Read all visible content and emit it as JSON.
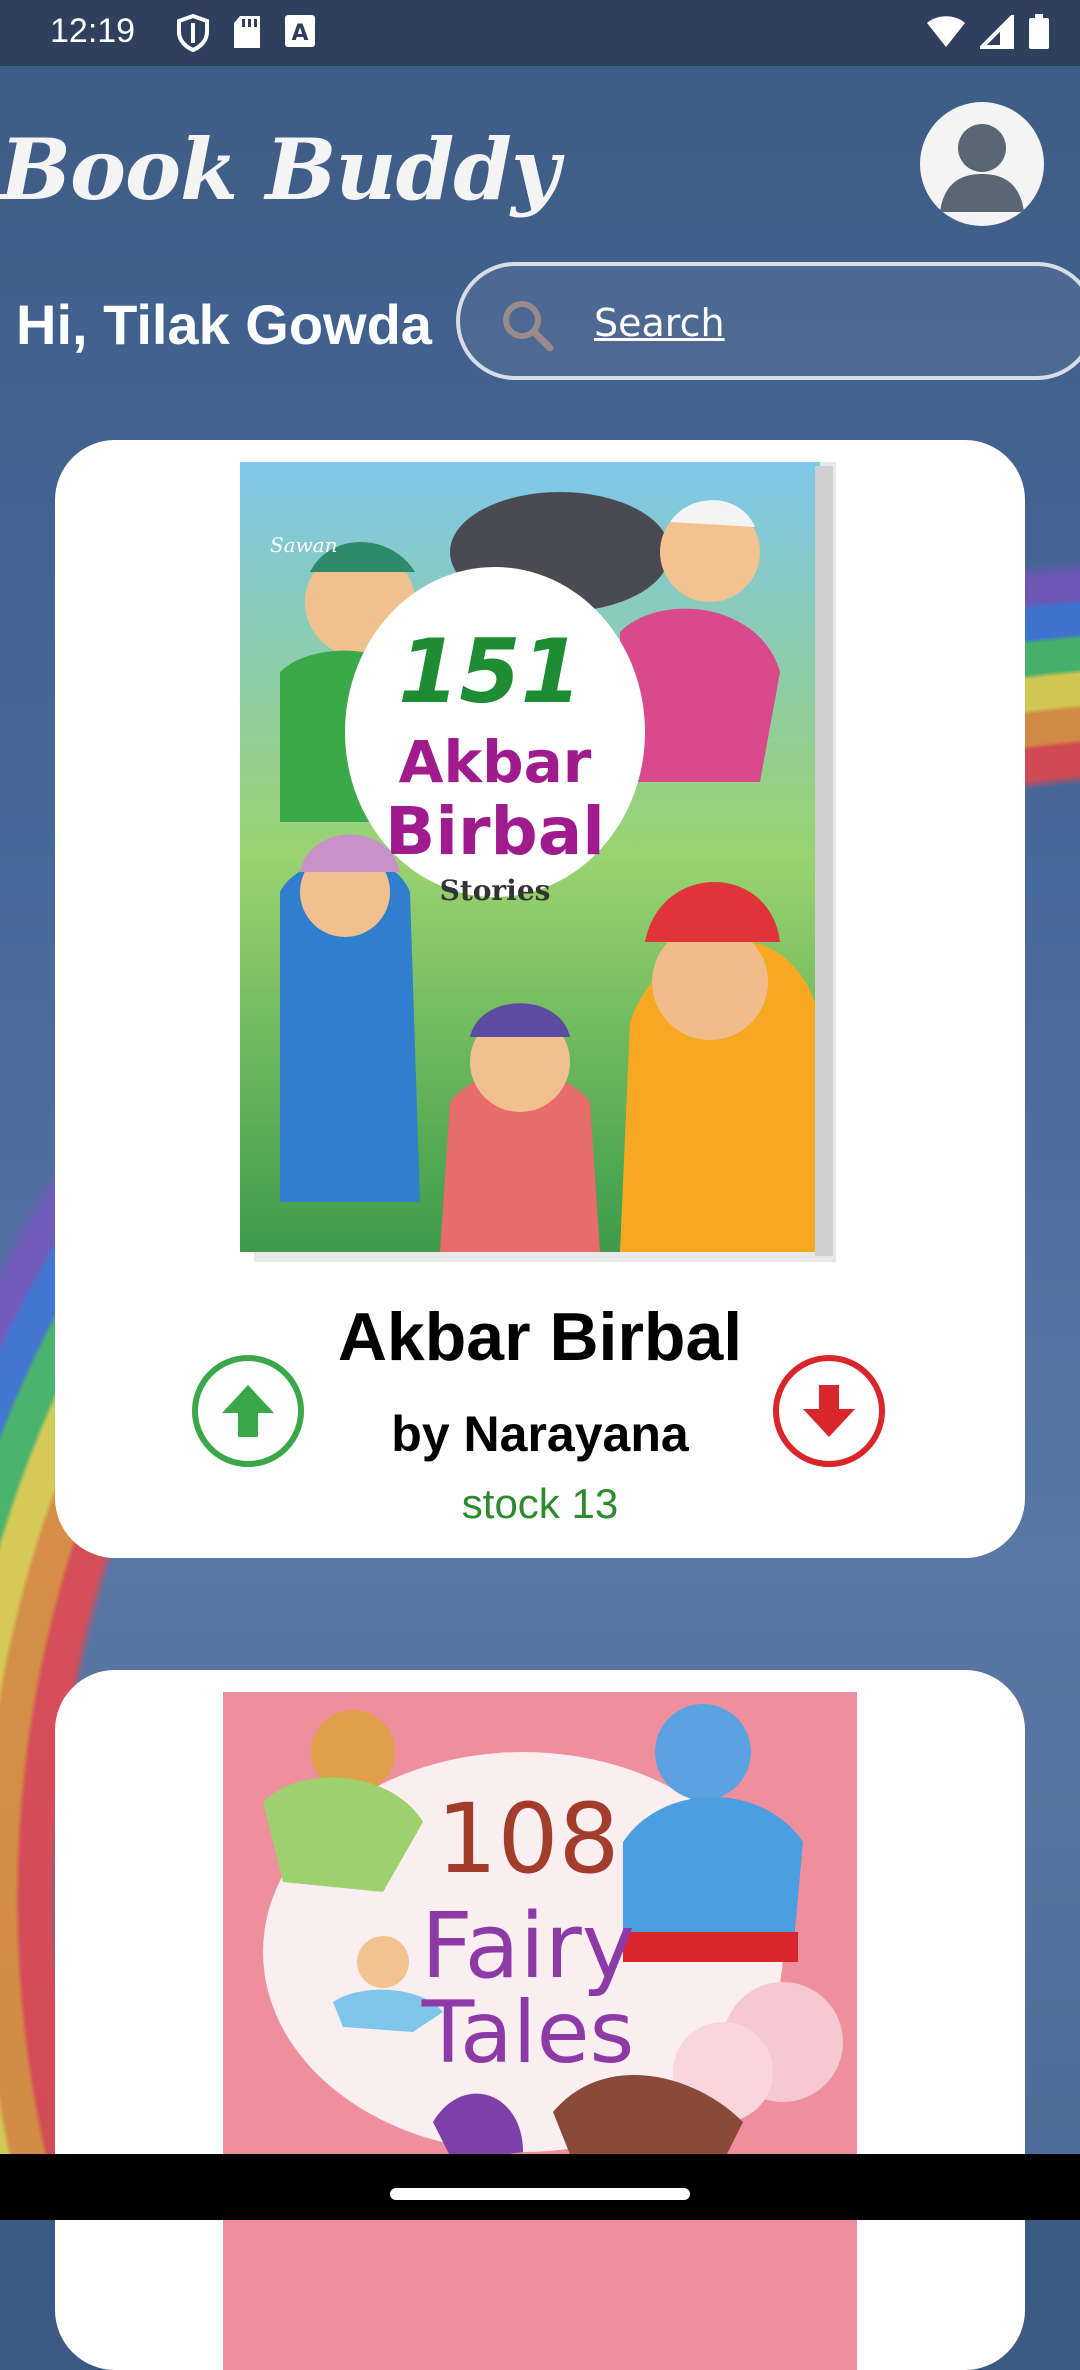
{
  "status_bar": {
    "time": "12:19",
    "left_icons": [
      "shield-icon",
      "sd-card-icon",
      "text-a-icon"
    ],
    "right_icons": [
      "wifi-icon",
      "cell-signal-icon",
      "battery-icon"
    ]
  },
  "app": {
    "title": "Book Buddy"
  },
  "header": {
    "greeting": "Hi, Tilak Gowda",
    "profile_icon": "user-avatar-icon"
  },
  "search": {
    "placeholder": "Search",
    "icon": "search-icon"
  },
  "books": [
    {
      "title": "Akbar Birbal",
      "author_line": "by Narayana",
      "stock_line": "stock 13",
      "cover_text": [
        "Sawan",
        "151",
        "Akbar",
        "Birbal",
        "Stories"
      ]
    },
    {
      "cover_text": [
        "108",
        "Fairy",
        "Tales"
      ]
    }
  ],
  "colors": {
    "stock_green": "#2f8a2f",
    "up_green": "#3aa84a",
    "down_red": "#d9262b"
  }
}
